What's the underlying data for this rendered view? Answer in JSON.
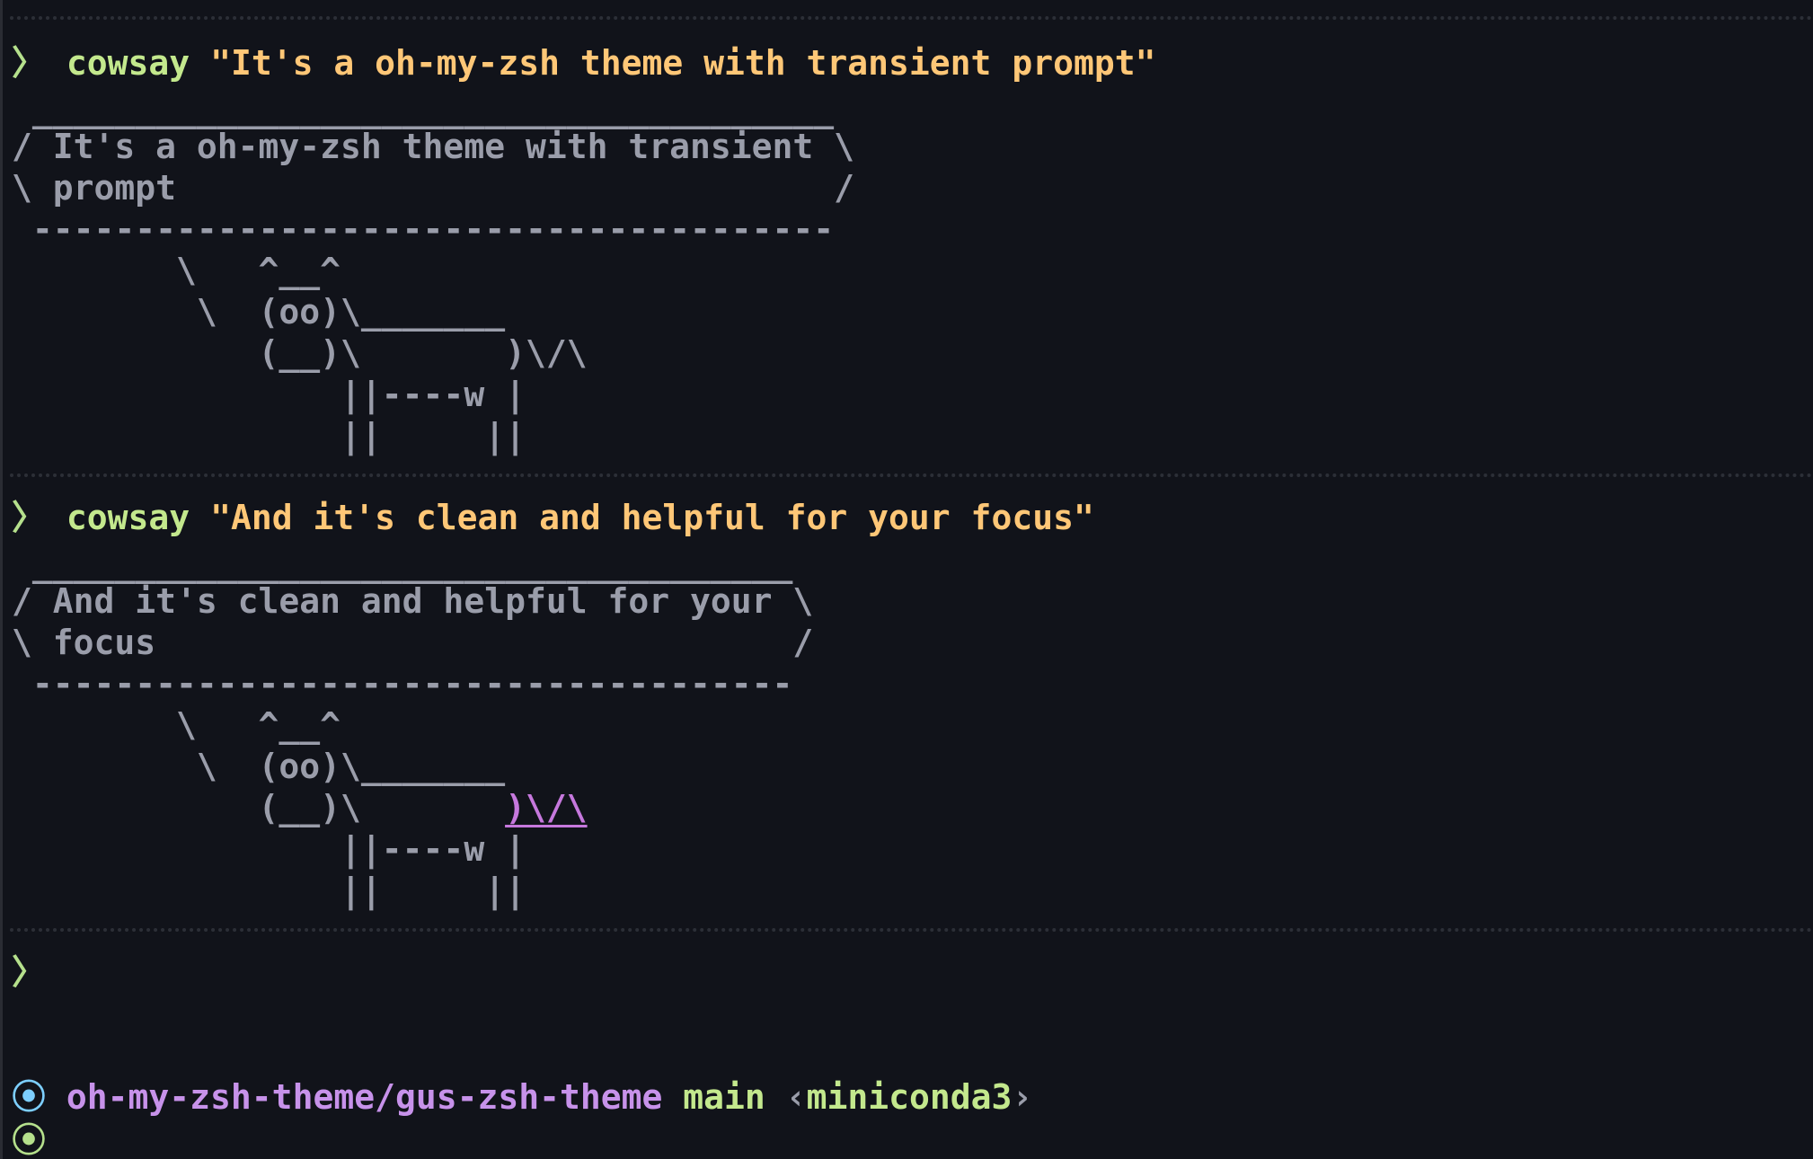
{
  "prompt_symbol": "〉",
  "blocks": [
    {
      "command": "cowsay",
      "argument": "\"It's a oh-my-zsh theme with transient prompt\"",
      "bubble": [
        " _______________________________________",
        "/ It's a oh-my-zsh theme with transient \\",
        "\\ prompt                                /",
        " ---------------------------------------"
      ],
      "cow": [
        "        \\   ^__^",
        "         \\  (oo)\\_______",
        "            (__)\\       )\\/\\",
        "                ||----w |",
        "                ||     ||"
      ]
    },
    {
      "command": "cowsay",
      "argument": "\"And it's clean and helpful for your focus\"",
      "bubble": [
        " _____________________________________",
        "/ And it's clean and helpful for your \\",
        "\\ focus                               /",
        " -------------------------------------"
      ],
      "cow": [
        "        \\   ^__^",
        "         \\  (oo)\\_______",
        "            (__)\\       ",
        "                ||----w |",
        "                ||     ||"
      ],
      "highlight_fragment": ")\\/\\"
    }
  ],
  "status": {
    "dot": "⦿",
    "path": "oh-my-zsh-theme/gus-zsh-theme",
    "branch": "main",
    "env": "miniconda3",
    "env_open": "‹",
    "env_close": "›"
  },
  "colors": {
    "background": "#11131a",
    "command": "#c3e88d",
    "string": "#ffc777",
    "path": "#c792ea",
    "dot": "#7dcfff",
    "text": "#9a9daa"
  }
}
